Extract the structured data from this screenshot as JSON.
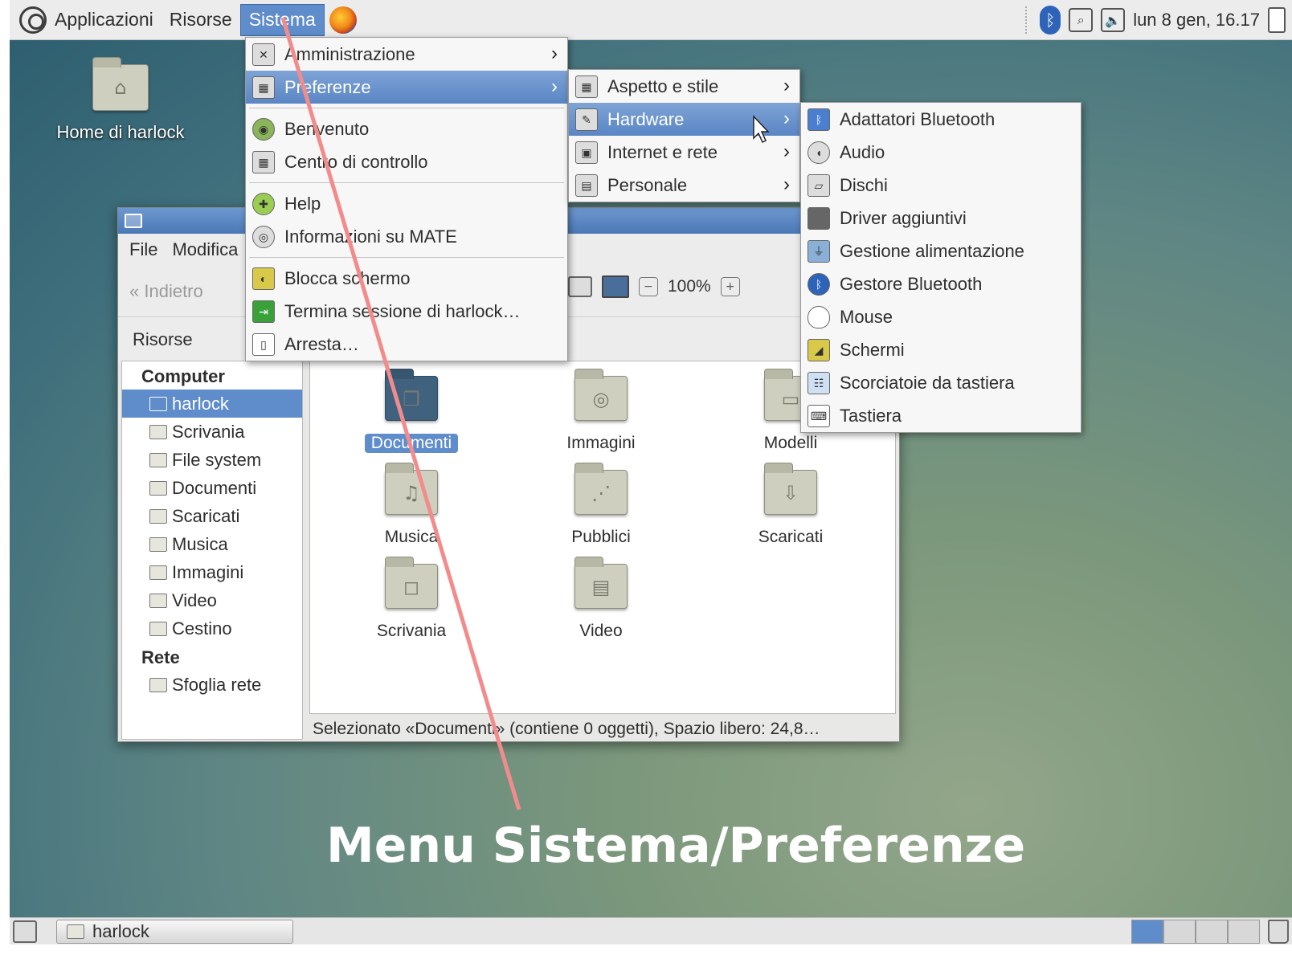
{
  "top_panel": {
    "menus": [
      "Applicazioni",
      "Risorse",
      "Sistema"
    ],
    "active_menu": "Sistema",
    "clock": "lun  8 gen, 16.17"
  },
  "desktop": {
    "home_icon_label": "Home di harlock"
  },
  "file_manager": {
    "menubar": [
      "File",
      "Modifica"
    ],
    "toolbar": {
      "back_label": "Indietro",
      "zoom": "100%"
    },
    "places_label": "Risorse",
    "sidebar": {
      "computer_header": "Computer",
      "computer_items": [
        "harlock",
        "Scrivania",
        "File system",
        "Documenti",
        "Scaricati",
        "Musica",
        "Immagini",
        "Video",
        "Cestino"
      ],
      "selected_item": "harlock",
      "network_header": "Rete",
      "network_items": [
        "Sfoglia rete"
      ]
    },
    "folders": [
      "Documenti",
      "Immagini",
      "Modelli",
      "Musica",
      "Pubblici",
      "Scaricati",
      "Scrivania",
      "Video"
    ],
    "selected_folder": "Documenti",
    "status": "Selezionato «Documenti» (contiene 0 oggetti), Spazio libero: 24,8…"
  },
  "menu_sistema": {
    "items": [
      "Amministrazione",
      "Preferenze",
      "Benvenuto",
      "Centro di controllo",
      "Help",
      "Informazioni su MATE",
      "Blocca schermo",
      "Termina sessione di harlock…",
      "Arresta…"
    ],
    "highlighted": "Preferenze"
  },
  "menu_preferenze": {
    "items": [
      "Aspetto e stile",
      "Hardware",
      "Internet e rete",
      "Personale"
    ],
    "highlighted": "Hardware"
  },
  "menu_hardware": {
    "items": [
      "Adattatori Bluetooth",
      "Audio",
      "Dischi",
      "Driver aggiuntivi",
      "Gestione alimentazione",
      "Gestore Bluetooth",
      "Mouse",
      "Schermi",
      "Scorciatoie da tastiera",
      "Tastiera"
    ]
  },
  "caption": "Menu Sistema/Preferenze",
  "bottom_panel": {
    "task_label": "harlock"
  },
  "colors": {
    "accent": "#5f8ccb",
    "annotation_line": "#f28c8c"
  }
}
